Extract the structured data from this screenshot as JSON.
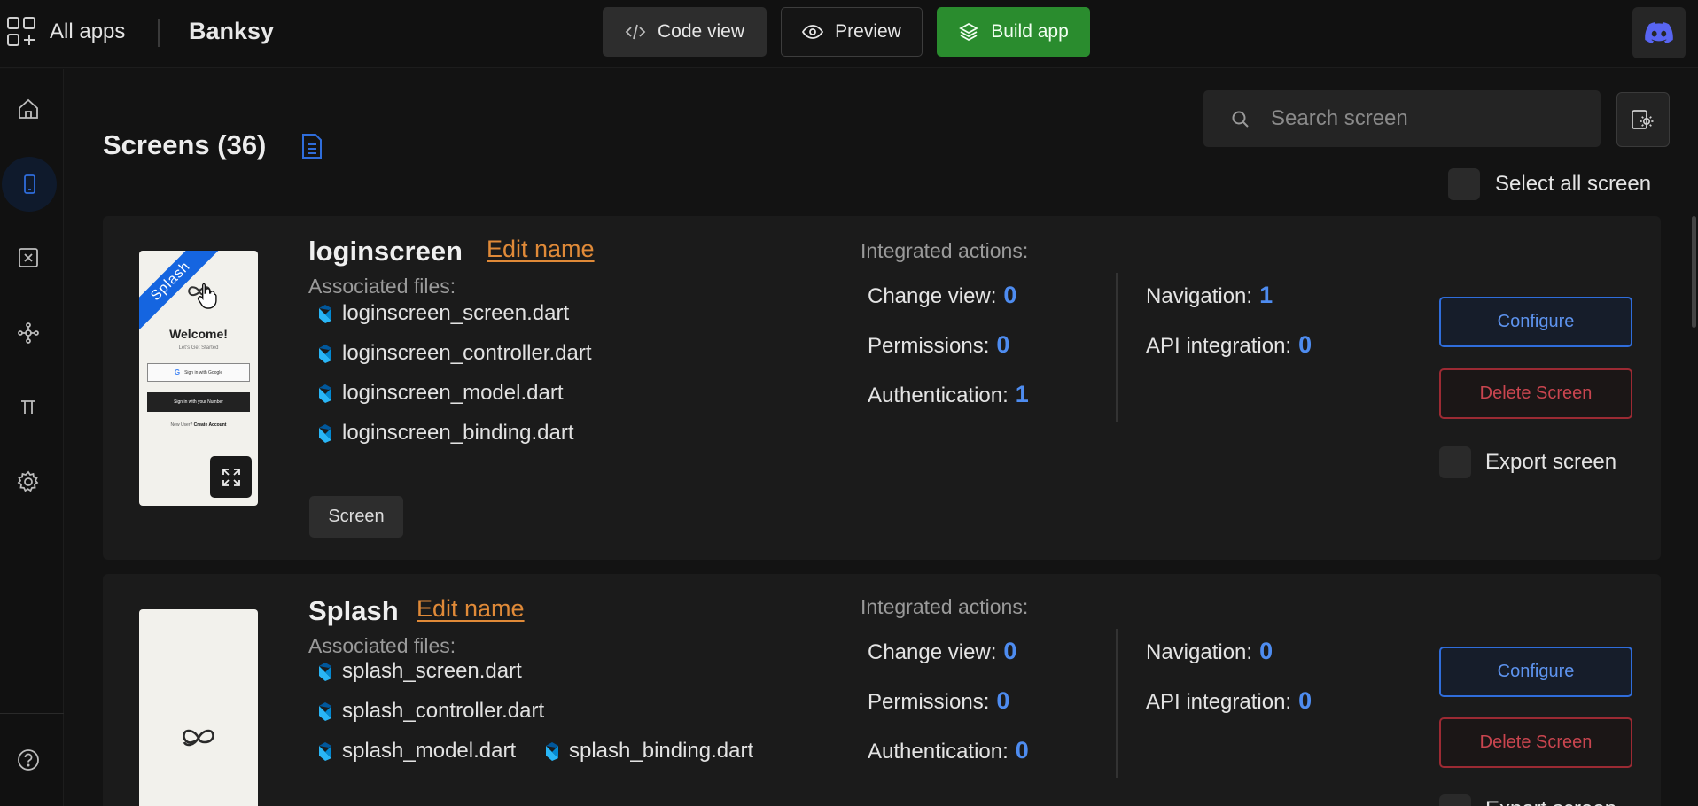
{
  "topbar": {
    "all_apps": "All apps",
    "project_name": "Banksy",
    "code_view": "Code view",
    "preview": "Preview",
    "build_app": "Build app"
  },
  "sidebar": {
    "items": [
      "home",
      "screens",
      "variables",
      "integrations",
      "constants",
      "settings"
    ],
    "active": "screens",
    "help_icon": "question-circle-icon"
  },
  "page": {
    "title": "Screens (36)",
    "search_placeholder": "Search screen",
    "select_all_label": "Select all screen"
  },
  "screens": [
    {
      "name": "loginscreen",
      "edit_label": "Edit name",
      "associated_label": "Associated files:",
      "files": [
        "loginscreen_screen.dart",
        "loginscreen_controller.dart",
        "loginscreen_model.dart",
        "loginscreen_binding.dart"
      ],
      "tag": "Screen",
      "ribbon": "Splash",
      "preview": {
        "welcome": "Welcome!",
        "subtitle": "Let's Get Started",
        "google_button": "Sign in with Google",
        "number_button": "Sign in with your Number",
        "footer_prefix": "New User?",
        "footer_link": "Create Account"
      },
      "integrated_label": "Integrated actions:",
      "actions": {
        "change_view_label": "Change view:",
        "change_view": "0",
        "permissions_label": "Permissions:",
        "permissions": "0",
        "authentication_label": "Authentication:",
        "authentication": "1",
        "navigation_label": "Navigation:",
        "navigation": "1",
        "api_label": "API integration:",
        "api": "0"
      },
      "configure": "Configure",
      "delete": "Delete Screen",
      "export": "Export screen"
    },
    {
      "name": "Splash",
      "edit_label": "Edit name",
      "associated_label": "Associated files:",
      "files": [
        "splash_screen.dart",
        "splash_controller.dart",
        "splash_model.dart",
        "splash_binding.dart"
      ],
      "integrated_label": "Integrated actions:",
      "actions": {
        "change_view_label": "Change view:",
        "change_view": "0",
        "permissions_label": "Permissions:",
        "permissions": "0",
        "authentication_label": "Authentication:",
        "authentication": "0",
        "navigation_label": "Navigation:",
        "navigation": "0",
        "api_label": "API integration:",
        "api": "0"
      },
      "configure": "Configure",
      "delete": "Delete Screen",
      "export": "Export screen"
    }
  ],
  "colors": {
    "accent_blue": "#4e8cf0",
    "build_green": "#2a8c2e",
    "edit_orange": "#e08a38",
    "delete_red": "#c9454f"
  }
}
